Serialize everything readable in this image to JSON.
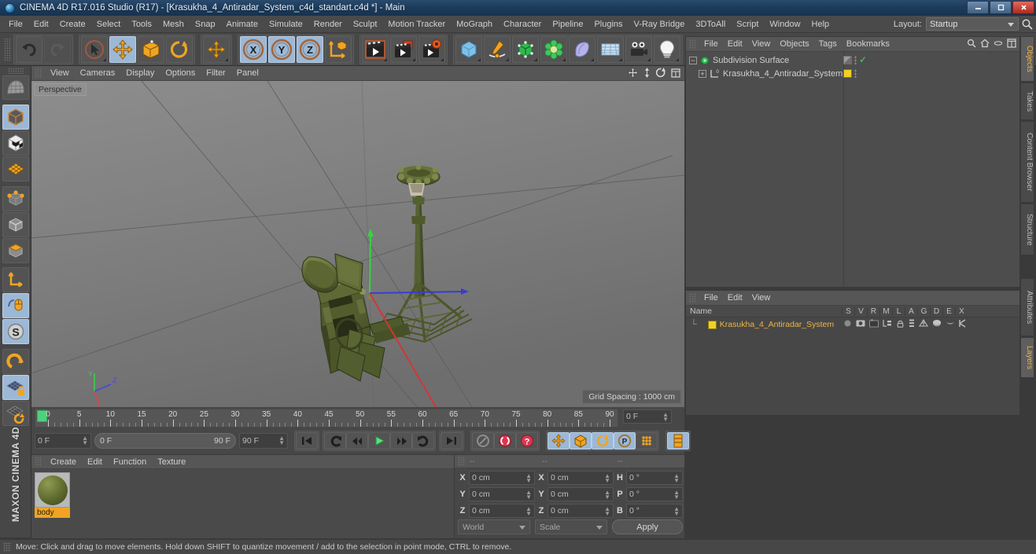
{
  "window": {
    "title": "CINEMA 4D R17.016 Studio (R17) - [Krasukha_4_Antiradar_System_c4d_standart.c4d *] - Main",
    "minimize": "—",
    "maximize": "❐",
    "close": "✕"
  },
  "menubar": {
    "items": [
      "File",
      "Edit",
      "Create",
      "Select",
      "Tools",
      "Mesh",
      "Snap",
      "Animate",
      "Simulate",
      "Render",
      "Sculpt",
      "Motion Tracker",
      "MoGraph",
      "Character",
      "Pipeline",
      "Plugins",
      "V-Ray Bridge",
      "3DToAll",
      "Script",
      "Window",
      "Help"
    ],
    "layout_label": "Layout:",
    "layout_value": "Startup",
    "search_icon": "search-icon"
  },
  "toolbar": {
    "groups": [
      {
        "name": "undo-redo",
        "buttons": [
          {
            "name": "undo",
            "icon": "undo-arrow-icon",
            "state": "normal"
          },
          {
            "name": "redo",
            "icon": "redo-arrow-icon",
            "state": "disabled"
          }
        ]
      },
      {
        "name": "transform-tools",
        "buttons": [
          {
            "name": "select",
            "icon": "cursor-arrow-icon",
            "state": "normal"
          },
          {
            "name": "move",
            "icon": "move-cross-icon",
            "state": "active"
          },
          {
            "name": "scale",
            "icon": "scale-box-icon",
            "state": "normal"
          },
          {
            "name": "rotate",
            "icon": "rotate-circle-icon",
            "state": "normal"
          }
        ]
      },
      {
        "name": "magnet",
        "buttons": [
          {
            "name": "magnet-tool",
            "icon": "move-cross-icon",
            "state": "normal"
          }
        ]
      },
      {
        "name": "axis-locks",
        "buttons": [
          {
            "name": "lock-x",
            "icon": "axis-x-icon",
            "state": "active",
            "label": "X"
          },
          {
            "name": "lock-y",
            "icon": "axis-y-icon",
            "state": "active",
            "label": "Y"
          },
          {
            "name": "lock-z",
            "icon": "axis-z-icon",
            "state": "active",
            "label": "Z"
          },
          {
            "name": "world-object-axis",
            "icon": "world-axis-cube-icon",
            "state": "normal"
          }
        ]
      },
      {
        "name": "render",
        "buttons": [
          {
            "name": "render-view",
            "icon": "render-clapper-icon",
            "state": "normal"
          },
          {
            "name": "render-picture-viewer",
            "icon": "render-picture-icon",
            "state": "normal"
          },
          {
            "name": "render-settings",
            "icon": "render-settings-gear-icon",
            "state": "normal"
          }
        ]
      },
      {
        "name": "objects",
        "buttons": [
          {
            "name": "add-cube",
            "icon": "cube-blue-icon",
            "state": "normal"
          },
          {
            "name": "add-spline",
            "icon": "pen-spline-icon",
            "state": "normal"
          },
          {
            "name": "generator",
            "icon": "generator-green-icon",
            "state": "normal"
          },
          {
            "name": "deformer",
            "icon": "deformer-flower-icon",
            "state": "normal"
          },
          {
            "name": "environment",
            "icon": "environment-blob-icon",
            "state": "normal"
          },
          {
            "name": "floor-sky",
            "icon": "floor-grid-icon",
            "state": "normal"
          },
          {
            "name": "camera",
            "icon": "camera-icon",
            "state": "normal"
          },
          {
            "name": "light",
            "icon": "light-bulb-icon",
            "state": "normal"
          }
        ]
      }
    ]
  },
  "left_toolbar": {
    "buttons": [
      {
        "name": "make-editable",
        "icon": "make-editable-icon",
        "state": "normal"
      },
      {
        "name": "model-mode",
        "icon": "model-cube-icon",
        "state": "active"
      },
      {
        "name": "texture-mode",
        "icon": "texture-checker-cube-icon",
        "state": "normal"
      },
      {
        "name": "workplane-mode",
        "icon": "workplane-grid-icon",
        "state": "normal"
      },
      {
        "name": "point-mode",
        "icon": "point-cube-icon",
        "state": "normal"
      },
      {
        "name": "edge-mode",
        "icon": "edge-cube-icon",
        "state": "normal"
      },
      {
        "name": "polygon-mode",
        "icon": "polygon-cube-icon",
        "state": "normal"
      },
      {
        "name": "axis-modify",
        "icon": "axis-corner-icon",
        "state": "normal"
      },
      {
        "name": "enable-axis",
        "icon": "mouse-axis-icon",
        "state": "active"
      },
      {
        "name": "soft-selection",
        "icon": "soft-selection-s-icon",
        "state": "active"
      },
      {
        "name": "snap-toggle",
        "icon": "magnet-snap-icon",
        "state": "normal"
      },
      {
        "name": "workplane-lock",
        "icon": "workplane-lock-icon",
        "state": "active"
      },
      {
        "name": "workplane-rotate",
        "icon": "workplane-rotate-icon",
        "state": "normal"
      }
    ],
    "brand": "MAXON CINEMA 4D"
  },
  "viewport": {
    "menu": [
      "View",
      "Cameras",
      "Display",
      "Filter",
      "Options",
      "Panel"
    ],
    "menu_order": [
      "View",
      "Cameras",
      "Display",
      "Options",
      "Filter",
      "Panel"
    ],
    "perspective_label": "Perspective",
    "grid_spacing": "Grid Spacing : 1000 cm",
    "nav_icons": [
      "pan-icon",
      "zoom-icon",
      "rotate-icon",
      "maximize-viewport-icon"
    ],
    "model_description": "Krasukha-4 antiradar system 3D model, olive green"
  },
  "timeline": {
    "tick_labels": [
      "0",
      "5",
      "10",
      "15",
      "20",
      "25",
      "30",
      "35",
      "40",
      "45",
      "50",
      "55",
      "60",
      "65",
      "70",
      "75",
      "80",
      "85",
      "90"
    ],
    "range_start": 0,
    "range_end": 90,
    "current_frame_field": "0 F",
    "start_field": "0 F",
    "preview_start": "0 F",
    "preview_end": "90 F",
    "end_field": "90 F",
    "buttons": [
      {
        "name": "go-to-start",
        "icon": "skip-start-icon",
        "state": "normal"
      },
      {
        "name": "play-reverse-loop",
        "icon": "loop-reverse-icon",
        "state": "normal"
      },
      {
        "name": "step-back",
        "icon": "step-back-icon",
        "state": "normal"
      },
      {
        "name": "play-forward",
        "icon": "play-icon",
        "state": "normal"
      },
      {
        "name": "step-forward",
        "icon": "step-forward-icon",
        "state": "normal"
      },
      {
        "name": "loop-playback",
        "icon": "loop-icon",
        "state": "normal"
      },
      {
        "name": "go-to-end",
        "icon": "skip-end-icon",
        "state": "normal"
      },
      {
        "name": "autokey-region",
        "icon": "autokey-gray-icon",
        "state": "disabled"
      },
      {
        "name": "record-active-objects",
        "icon": "record-red-icon",
        "state": "normal"
      },
      {
        "name": "autokeying",
        "icon": "autokey-red-icon",
        "state": "normal"
      },
      {
        "name": "key-position",
        "icon": "key-position-icon",
        "state": "active"
      },
      {
        "name": "key-scale",
        "icon": "key-scale-icon",
        "state": "active"
      },
      {
        "name": "key-rotation",
        "icon": "key-rotation-icon",
        "state": "active"
      },
      {
        "name": "key-param",
        "icon": "key-param-p-icon",
        "state": "active"
      },
      {
        "name": "key-pla",
        "icon": "key-pla-dots-icon",
        "state": "normal"
      },
      {
        "name": "animation-layers",
        "icon": "animation-layer-icon",
        "state": "active"
      }
    ]
  },
  "material_manager": {
    "menu": [
      "Create",
      "Edit",
      "Function",
      "Texture"
    ],
    "materials": [
      {
        "name": "body",
        "selected": true
      }
    ]
  },
  "coordinates": {
    "headers": [
      "--",
      "--",
      "--"
    ],
    "rows": [
      {
        "pos_label": "X",
        "pos_value": "0 cm",
        "size_label": "X",
        "size_value": "0 cm",
        "rot_label": "H",
        "rot_value": "0 °"
      },
      {
        "pos_label": "Y",
        "pos_value": "0 cm",
        "size_label": "Y",
        "size_value": "0 cm",
        "rot_label": "P",
        "rot_value": "0 °"
      },
      {
        "pos_label": "Z",
        "pos_value": "0 cm",
        "size_label": "Z",
        "size_value": "0 cm",
        "rot_label": "B",
        "rot_value": "0 °"
      }
    ],
    "world_select": "World",
    "scale_select": "Scale",
    "apply_button": "Apply"
  },
  "object_manager": {
    "menu": [
      "File",
      "Edit",
      "View",
      "Objects",
      "Tags",
      "Bookmarks"
    ],
    "header_icons": [
      "search-icon",
      "home-icon",
      "minus-icon",
      "expand-icon"
    ],
    "objects": [
      {
        "name": "Subdivision Surface",
        "icon": "subdivision-surface-icon",
        "indent": 0,
        "check": "✓",
        "tag_color": "#8a8a8a"
      },
      {
        "name": "Krasukha_4_Antiradar_System",
        "icon": "null-object-icon",
        "indent": 1,
        "check": "",
        "tag_color": "#f2d024"
      }
    ]
  },
  "layer_manager": {
    "menu": [
      "File",
      "Edit",
      "View"
    ],
    "columns": [
      "Name",
      "S",
      "V",
      "R",
      "M",
      "L",
      "A",
      "G",
      "D",
      "E",
      "X"
    ],
    "rows": [
      {
        "name": "Krasukha_4_Antiradar_System",
        "color": "#f2d024"
      }
    ]
  },
  "side_tabs": {
    "top": [
      {
        "label": "Objects",
        "selected": true
      },
      {
        "label": "Takes",
        "selected": false
      },
      {
        "label": "Content Browser",
        "selected": false
      },
      {
        "label": "Structure",
        "selected": false
      }
    ],
    "bottom": [
      {
        "label": "Attributes",
        "selected": false
      },
      {
        "label": "Layers",
        "selected": true
      }
    ]
  },
  "statusbar": {
    "text": "Move: Click and drag to move elements. Hold down SHIFT to quantize movement / add to the selection in point mode, CTRL to remove."
  },
  "colors": {
    "accent_orange": "#f0a422",
    "active_blue": "#9cb8d6",
    "panel_bg": "#474747",
    "viewport_bg": "#7b7b7b",
    "axis_x": "#d03a3a",
    "axis_y": "#4fd04f",
    "axis_z": "#4444d8",
    "layer_yellow": "#f2d024"
  }
}
